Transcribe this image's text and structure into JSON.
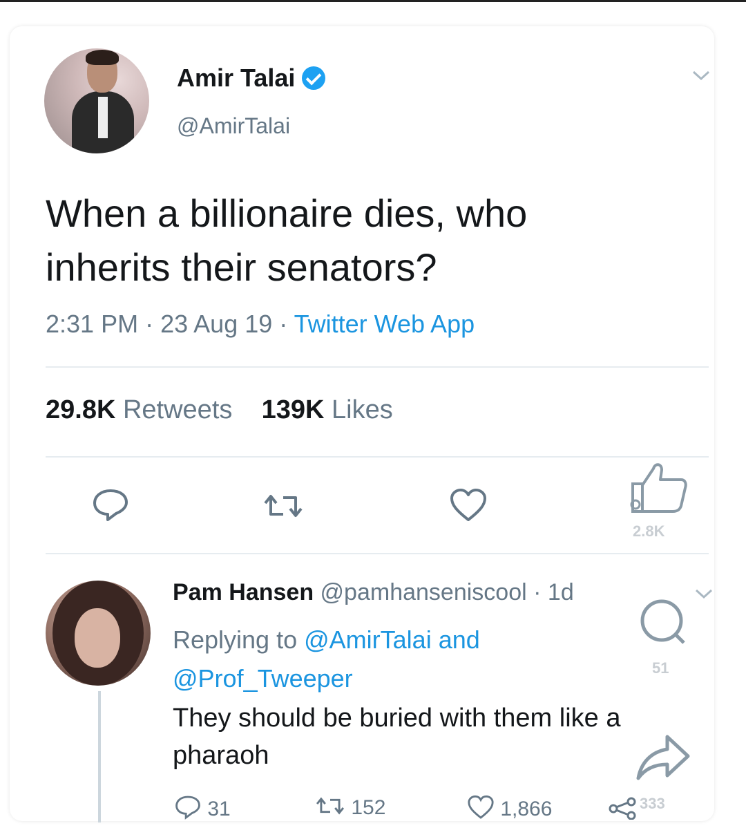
{
  "tweet": {
    "author_name": "Amir Talai",
    "author_handle": "@AmirTalai",
    "text": "When a billionaire dies, who inherits their senators?",
    "time": "2:31 PM",
    "date": "23 Aug 19",
    "source": "Twitter Web App",
    "retweets_count": "29.8K",
    "retweets_label": "Retweets",
    "likes_count": "139K",
    "likes_label": "Likes",
    "overlay_like_count": "2.8K"
  },
  "reply": {
    "author_name": "Pam Hansen",
    "author_handle": "@pamhanseniscool",
    "age": "1d",
    "replying_prefix": "Replying to",
    "mention_1": "@AmirTalai",
    "and_word": "and",
    "mention_2": "@Prof_Tweeper",
    "text": "They should be buried with them like a pharaoh",
    "reply_count": "31",
    "retweet_count": "152",
    "like_count": "1,866",
    "overlay_comment_count": "51",
    "overlay_share_count": "333"
  },
  "colors": {
    "link": "#1b95e0",
    "verified": "#1da1f2",
    "muted": "#657786",
    "divider": "#e6ecf0"
  }
}
